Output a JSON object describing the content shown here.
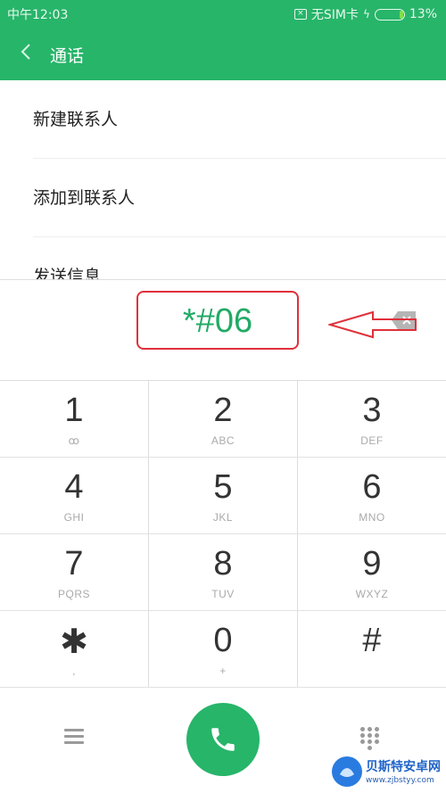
{
  "status_bar": {
    "time": "中午12:03",
    "sim_status": "无SIM卡",
    "battery_percent": "13%",
    "battery_level": 0.13,
    "icons": [
      "no-sim-icon",
      "charging-icon",
      "battery-icon"
    ]
  },
  "header": {
    "title": "通话",
    "back_icon": "chevron-left-icon",
    "color": "#27b56a"
  },
  "menu": {
    "items": [
      {
        "label": "新建联系人"
      },
      {
        "label": "添加到联系人"
      },
      {
        "label": "发送信息"
      }
    ]
  },
  "dialer": {
    "number": "*#06",
    "number_color": "#22aa66",
    "annotation_color": "#e0303a",
    "backspace_icon": "backspace-icon"
  },
  "keypad": {
    "rows": [
      [
        {
          "digit": "1",
          "letters": "ꝏ"
        },
        {
          "digit": "2",
          "letters": "ABC"
        },
        {
          "digit": "3",
          "letters": "DEF"
        }
      ],
      [
        {
          "digit": "4",
          "letters": "GHI"
        },
        {
          "digit": "5",
          "letters": "JKL"
        },
        {
          "digit": "6",
          "letters": "MNO"
        }
      ],
      [
        {
          "digit": "7",
          "letters": "PQRS"
        },
        {
          "digit": "8",
          "letters": "TUV"
        },
        {
          "digit": "9",
          "letters": "WXYZ"
        }
      ],
      [
        {
          "digit": "✱",
          "letters": ","
        },
        {
          "digit": "0",
          "letters": "+"
        },
        {
          "digit": "#",
          "letters": ""
        }
      ]
    ]
  },
  "bottom_bar": {
    "menu_icon": "hamburger-menu-icon",
    "call_icon": "phone-icon",
    "dialpad_icon": "dialpad-icon",
    "call_color": "#27b56a"
  },
  "watermark": {
    "name": "贝斯特安卓网",
    "url": "www.zjbstyy.com"
  }
}
